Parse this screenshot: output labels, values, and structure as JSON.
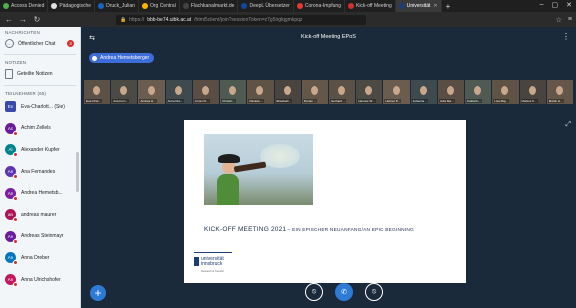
{
  "browser": {
    "tabs": [
      {
        "label": "Access Denied",
        "color": "#4caf50"
      },
      {
        "label": "Pädagogische",
        "color": "#e0e0e0"
      },
      {
        "label": "Druck_Julian",
        "color": "#1565c0"
      },
      {
        "label": "Org Central",
        "color": "#ffb300"
      },
      {
        "label": "Flachkanalmarkt.de",
        "color": "#424242"
      },
      {
        "label": "DeepL Übersetzer",
        "color": "#0d47a1"
      },
      {
        "label": "Corona-Impfung",
        "color": "#e53935"
      },
      {
        "label": "Kick-off Meeting",
        "color": "#d32f2f"
      },
      {
        "label": "Universität",
        "color": "#1e3b7a"
      }
    ],
    "url_host": "bbb-be74.uibk.ac.at",
    "url_rest": "/html5client/join?sessionToken=z7g5irglqgmkpqz",
    "url_prefix": "https://"
  },
  "sidebar": {
    "messages_header": "NACHRICHTEN",
    "public_chat_label": "Öffentlicher Chat",
    "public_chat_count": "3",
    "notes_header": "NOTIZEN",
    "shared_notes_label": "Geteilte Notizen",
    "participants_header": "TEILNEHMER (65)",
    "users": [
      {
        "initials": "Ev",
        "name": "Eva-Charlott... (Sie)",
        "color": "#3949ab"
      },
      {
        "initials": "Ac",
        "name": "Achim Zellels",
        "color": "#6a1b9a"
      },
      {
        "initials": "Al",
        "name": "Alexander Kupfer",
        "color": "#00838f"
      },
      {
        "initials": "An",
        "name": "Ana Fernandes",
        "color": "#5e35b1"
      },
      {
        "initials": "An",
        "name": "Andrea Hemetsb...",
        "color": "#7b1fa2"
      },
      {
        "initials": "an",
        "name": "andreas maurer",
        "color": "#ad1457"
      },
      {
        "initials": "An",
        "name": "Andreas Steinmayr",
        "color": "#6a1b9a"
      },
      {
        "initials": "An",
        "name": "Anna Dreber",
        "color": "#0277bd"
      },
      {
        "initials": "An",
        "name": "Anna Ulrichshofer",
        "color": "#c2185b"
      }
    ]
  },
  "main": {
    "meeting_title": "Kick-off Meeting EPoS",
    "current_speaker": "Andrea Hemetsberger",
    "webcam_names": [
      "Eva-Char...",
      "Ana Fern...",
      "Andrea H...",
      "Anna Dre...",
      "Armin Kl...",
      "Christin...",
      "Daniela ...",
      "Elisabeth...",
      "Florian ...",
      "Gerhard ...",
      "Hannes W...",
      "Helmut P...",
      "Johanna ...",
      "Julia Ma...",
      "Katharin...",
      "Lisa Maj...",
      "Markus K...",
      "Martin H..."
    ],
    "slide": {
      "title": "KICK-OFF MEETING 2021",
      "subtitle": " – EIN EPISCHER NEUANFANG/AN EPIC BEGINNING",
      "logo_line1": "universität",
      "logo_line2": "innsbruck",
      "logo_small": "Research & Transfer"
    }
  },
  "colors": {
    "accent": "#2e7bd6",
    "background": "#1b2a3a",
    "alert": "#d32f2f"
  }
}
